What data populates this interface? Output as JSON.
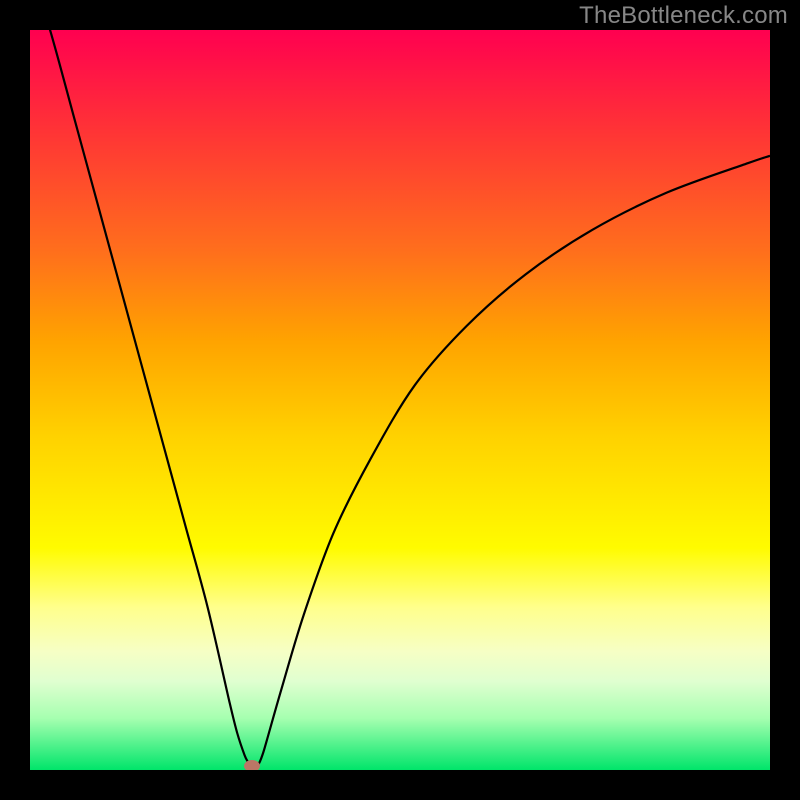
{
  "watermark": "TheBottleneck.com",
  "chart_data": {
    "type": "line",
    "title": "",
    "subtitle": "",
    "xlabel": "",
    "ylabel": "",
    "xlim": [
      0,
      100
    ],
    "ylim": [
      0,
      100
    ],
    "grid": false,
    "legend": null,
    "x": [
      0,
      3,
      6,
      9,
      12,
      15,
      18,
      21,
      24,
      27,
      28,
      29,
      29.5,
      30,
      30.5,
      31,
      31.5,
      32,
      34,
      37,
      41,
      46,
      52,
      59,
      67,
      76,
      86,
      97,
      100
    ],
    "values": [
      109,
      99,
      88,
      77,
      66,
      55,
      44,
      33,
      22,
      9,
      5,
      2,
      1,
      0,
      0.3,
      1,
      2.3,
      4,
      11,
      21,
      32,
      42,
      52,
      60,
      67,
      73,
      78,
      82,
      83
    ],
    "marker_point": {
      "x": 30,
      "y": 0
    },
    "background_gradient": {
      "direction": "vertical",
      "stops": [
        {
          "pos": 0.0,
          "color": "#ff0050"
        },
        {
          "pos": 0.14,
          "color": "#ff3535"
        },
        {
          "pos": 0.3,
          "color": "#ff6f1c"
        },
        {
          "pos": 0.42,
          "color": "#ffa300"
        },
        {
          "pos": 0.55,
          "color": "#ffd200"
        },
        {
          "pos": 0.7,
          "color": "#fffb00"
        },
        {
          "pos": 0.78,
          "color": "#ffff8c"
        },
        {
          "pos": 0.84,
          "color": "#f6ffc5"
        },
        {
          "pos": 0.88,
          "color": "#e0ffd0"
        },
        {
          "pos": 0.93,
          "color": "#a6ffb0"
        },
        {
          "pos": 1.0,
          "color": "#00e56a"
        }
      ]
    },
    "line_color": "#000000",
    "marker_color": "#bb7766"
  }
}
